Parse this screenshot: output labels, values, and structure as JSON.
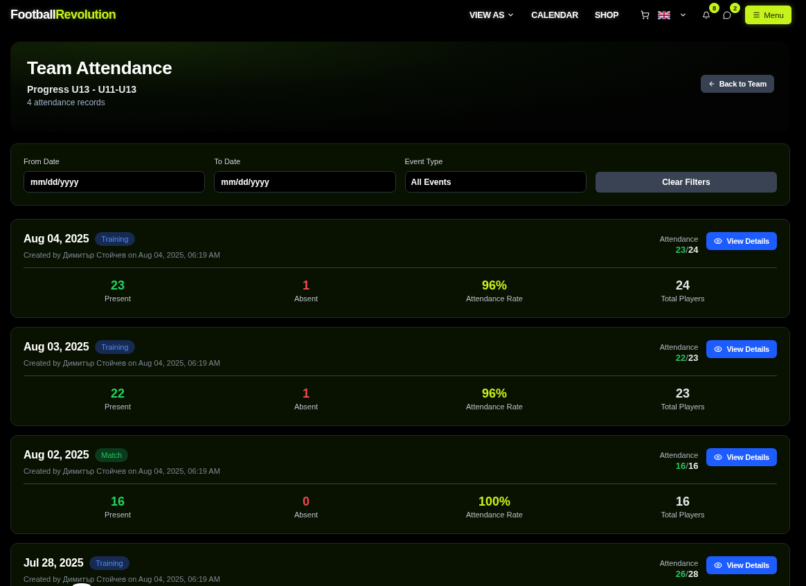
{
  "navbar": {
    "logo": {
      "text": "Football",
      "accent": "Revolution"
    },
    "links": [
      {
        "label": "VIEW AS",
        "dropdown": true
      },
      {
        "label": "CALENDAR",
        "dropdown": false
      },
      {
        "label": "SHOP",
        "dropdown": false
      }
    ],
    "notifications": {
      "count": "8"
    },
    "messages": {
      "count": "2"
    },
    "menu_button": {
      "label": "Menu"
    }
  },
  "header": {
    "title": "Team Attendance",
    "team": "Progress U13 - U11-U13",
    "record_count": "4 attendance records",
    "back_button": {
      "label": "Back to Team"
    }
  },
  "filters": {
    "fields": [
      {
        "kind": "date",
        "label": "From Date",
        "placeholder": "mm/dd/yyyy"
      },
      {
        "kind": "date",
        "label": "To Date",
        "placeholder": "mm/dd/yyyy"
      },
      {
        "kind": "select",
        "label": "Event Type",
        "value": "All Events"
      }
    ],
    "clear_button": {
      "label": "Clear Filters"
    }
  },
  "records": [
    {
      "date": "Aug 04, 2025",
      "event_type": {
        "label": "Training",
        "kind": "training"
      },
      "created": "Created by Димитър Стойчев on Aug 04, 2025, 06:19 AM",
      "attendance": {
        "label": "Attendance",
        "present": "23",
        "separator": "/",
        "total": "24"
      },
      "details_button": {
        "label": "View Details"
      },
      "stats": [
        {
          "kind": "present",
          "value": "23",
          "label": "Present"
        },
        {
          "kind": "absent",
          "value": "1",
          "label": "Absent"
        },
        {
          "kind": "rate",
          "value": "96%",
          "label": "Attendance Rate"
        },
        {
          "kind": "total",
          "value": "24",
          "label": "Total Players"
        }
      ]
    },
    {
      "date": "Aug 03, 2025",
      "event_type": {
        "label": "Training",
        "kind": "training"
      },
      "created": "Created by Димитър Стойчев on Aug 04, 2025, 06:19 AM",
      "attendance": {
        "label": "Attendance",
        "present": "22",
        "separator": "/",
        "total": "23"
      },
      "details_button": {
        "label": "View Details"
      },
      "stats": [
        {
          "kind": "present",
          "value": "22",
          "label": "Present"
        },
        {
          "kind": "absent",
          "value": "1",
          "label": "Absent"
        },
        {
          "kind": "rate",
          "value": "96%",
          "label": "Attendance Rate"
        },
        {
          "kind": "total",
          "value": "23",
          "label": "Total Players"
        }
      ]
    },
    {
      "date": "Aug 02, 2025",
      "event_type": {
        "label": "Match",
        "kind": "match"
      },
      "created": "Created by Димитър Стойчев on Aug 04, 2025, 06:19 AM",
      "attendance": {
        "label": "Attendance",
        "present": "16",
        "separator": "/",
        "total": "16"
      },
      "details_button": {
        "label": "View Details"
      },
      "stats": [
        {
          "kind": "present",
          "value": "16",
          "label": "Present"
        },
        {
          "kind": "absent",
          "value": "0",
          "label": "Absent"
        },
        {
          "kind": "rate",
          "value": "100%",
          "label": "Attendance Rate"
        },
        {
          "kind": "total",
          "value": "16",
          "label": "Total Players"
        }
      ]
    },
    {
      "date": "Jul 28, 2025",
      "event_type": {
        "label": "Training",
        "kind": "training"
      },
      "created": "Created by Димитър Стойчев on Aug 04, 2025, 06:19 AM",
      "attendance": {
        "label": "Attendance",
        "present": "26",
        "separator": "/",
        "total": "28"
      },
      "details_button": {
        "label": "View Details"
      }
    }
  ]
}
